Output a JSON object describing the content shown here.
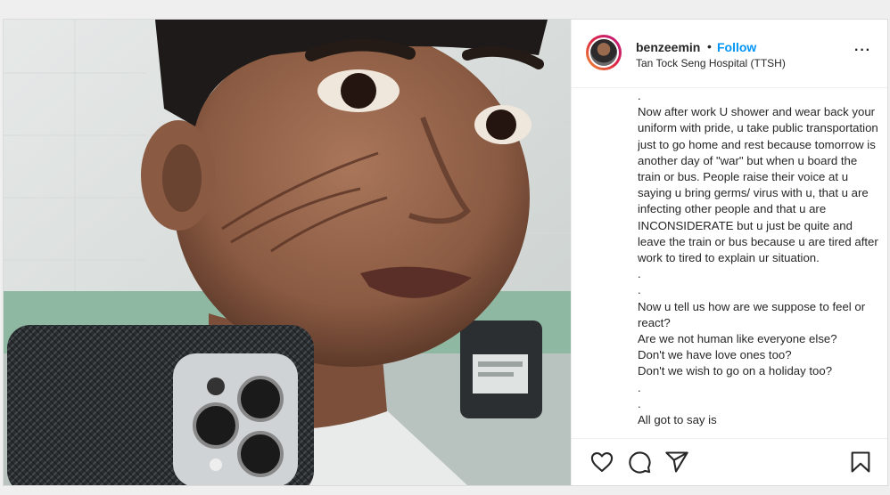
{
  "post": {
    "username": "benzeemin",
    "separator": "•",
    "follow_label": "Follow",
    "location": "Tan Tock Seng Hospital (TTSH)",
    "more_label": "···",
    "caption_paragraphs": [
      ".",
      "Now after work U shower and wear back your uniform with pride, u take public transportation just to go home and rest because tomorrow is another day of \"war\" but when u board the train or bus. People raise their voice at u saying u bring germs/ virus with u, that u are infecting other people and that u are INCONSIDERATE but u just be quite and leave the train or bus because u are tired after work to tired to explain ur situation.",
      ".",
      ".",
      "Now u tell us how are we suppose to feel or react?\nAre we not human like everyone else?\nDon't we have love ones too?\nDon't we wish to go on a holiday too?",
      ".",
      ".",
      "All got to say is"
    ]
  },
  "icons": {
    "like": "heart-icon",
    "comment": "comment-icon",
    "share": "share-icon",
    "save": "bookmark-icon"
  },
  "colors": {
    "follow": "#0095f6",
    "text": "#262626",
    "border": "#dbdbdb"
  }
}
